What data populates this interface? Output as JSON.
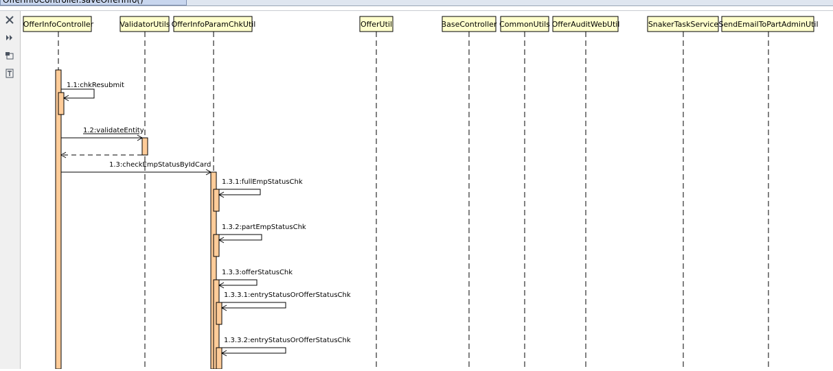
{
  "window": {
    "tab_title": "OfferInfoController.saveOfferInfo()"
  },
  "toolbar": [
    {
      "icon": "close-icon"
    },
    {
      "icon": "expand-icon"
    },
    {
      "icon": "layout-icon"
    },
    {
      "icon": "text-icon"
    }
  ],
  "colors": {
    "lifeline_fill": "#ffffcc",
    "activation_fill": "#ffcc99",
    "line": "#000000"
  },
  "lifelines": [
    {
      "id": "offerinfocontroller",
      "label": "OfferInfoController"
    },
    {
      "id": "validatorutils",
      "label": "ValidatorUtils"
    },
    {
      "id": "offerinfoparamchkutil",
      "label": "OfferInfoParamChkUtil"
    },
    {
      "id": "offerutil",
      "label": "OfferUtil"
    },
    {
      "id": "basecontroller",
      "label": "BaseController"
    },
    {
      "id": "commonutils",
      "label": "CommonUtils"
    },
    {
      "id": "offerauditwebutil",
      "label": "OfferAuditWebUtil"
    },
    {
      "id": "snakertaskservice",
      "label": "SnakerTaskService"
    },
    {
      "id": "sendemailtopartadminutil",
      "label": "SendEmailToPartAdminUtil"
    }
  ],
  "messages": [
    {
      "id": "m1-1",
      "label": "1.1:chkResubmit",
      "from": "offerinfocontroller",
      "to": "offerinfocontroller",
      "kind": "self"
    },
    {
      "id": "m1-2",
      "label": "1.2:validateEntity",
      "from": "offerinfocontroller",
      "to": "validatorutils",
      "kind": "call"
    },
    {
      "id": "m1-2-return",
      "label": "",
      "from": "validatorutils",
      "to": "offerinfocontroller",
      "kind": "return"
    },
    {
      "id": "m1-3",
      "label": "1.3:checkEmpStatusByIdCard",
      "from": "offerinfocontroller",
      "to": "offerinfoparamchkutil",
      "kind": "call"
    },
    {
      "id": "m1-3-1",
      "label": "1.3.1:fullEmpStatusChk",
      "from": "offerinfoparamchkutil",
      "to": "offerinfoparamchkutil",
      "kind": "self"
    },
    {
      "id": "m1-3-2",
      "label": "1.3.2:partEmpStatusChk",
      "from": "offerinfoparamchkutil",
      "to": "offerinfoparamchkutil",
      "kind": "self"
    },
    {
      "id": "m1-3-3",
      "label": "1.3.3:offerStatusChk",
      "from": "offerinfoparamchkutil",
      "to": "offerinfoparamchkutil",
      "kind": "self"
    },
    {
      "id": "m1-3-3-1",
      "label": "1.3.3.1:entryStatusOrOfferStatusChk",
      "from": "offerinfoparamchkutil",
      "to": "offerinfoparamchkutil",
      "kind": "self"
    },
    {
      "id": "m1-3-3-2",
      "label": "1.3.3.2:entryStatusOrOfferStatusChk",
      "from": "offerinfoparamchkutil",
      "to": "offerinfoparamchkutil",
      "kind": "self"
    }
  ]
}
